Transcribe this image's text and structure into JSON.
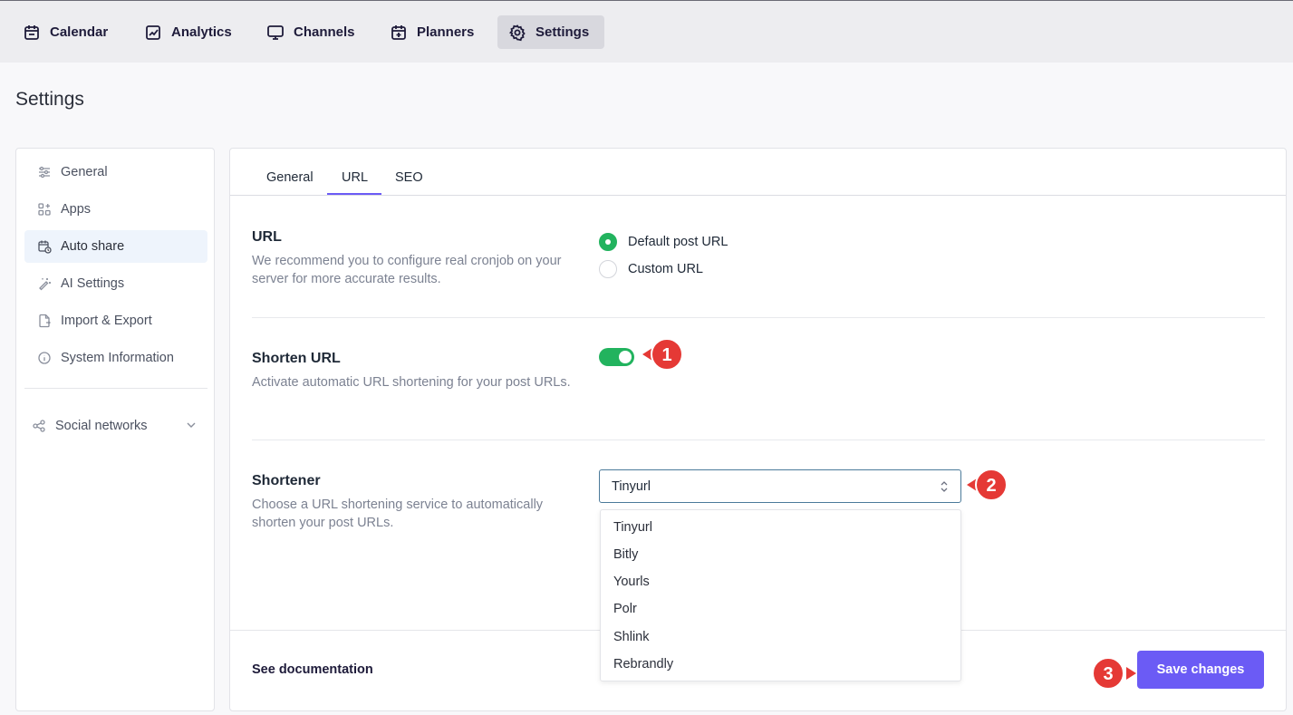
{
  "nav": {
    "items": [
      {
        "label": "Calendar",
        "icon": "calendar-icon"
      },
      {
        "label": "Analytics",
        "icon": "chart-icon"
      },
      {
        "label": "Channels",
        "icon": "monitor-icon"
      },
      {
        "label": "Planners",
        "icon": "calendar-plus-icon"
      },
      {
        "label": "Settings",
        "icon": "gear-icon",
        "active": true
      }
    ]
  },
  "page": {
    "title": "Settings"
  },
  "sidebar": {
    "items": [
      {
        "label": "General",
        "icon": "sliders-icon"
      },
      {
        "label": "Apps",
        "icon": "apps-icon"
      },
      {
        "label": "Auto share",
        "icon": "calendar-clock-icon",
        "active": true
      },
      {
        "label": "AI Settings",
        "icon": "magic-wand-icon"
      },
      {
        "label": "Import & Export",
        "icon": "file-export-icon"
      },
      {
        "label": "System Information",
        "icon": "info-icon"
      }
    ],
    "social": {
      "label": "Social networks",
      "icon": "share-icon"
    }
  },
  "tabs": [
    {
      "label": "General"
    },
    {
      "label": "URL",
      "active": true
    },
    {
      "label": "SEO"
    }
  ],
  "sections": {
    "url": {
      "title": "URL",
      "description": "We recommend you to configure real cronjob on your server for more accurate results.",
      "options": [
        {
          "label": "Default post URL",
          "selected": true
        },
        {
          "label": "Custom URL",
          "selected": false
        }
      ]
    },
    "shorten": {
      "title": "Shorten URL",
      "description": "Activate automatic URL shortening for your post URLs.",
      "enabled": true
    },
    "shortener": {
      "title": "Shortener",
      "description": "Choose a URL shortening service to automatically shorten your post URLs.",
      "selected": "Tinyurl",
      "options": [
        "Tinyurl",
        "Bitly",
        "Yourls",
        "Polr",
        "Shlink",
        "Rebrandly"
      ]
    }
  },
  "footer": {
    "doc_link": "See documentation",
    "save_label": "Save changes"
  },
  "markers": [
    "1",
    "2",
    "3"
  ],
  "colors": {
    "accent": "#6b5bf5",
    "toggle_on": "#22b35e",
    "marker": "#e53935"
  }
}
